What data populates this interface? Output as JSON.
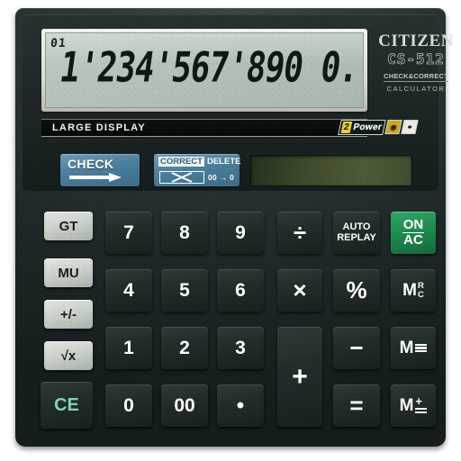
{
  "device": {
    "brand": "CITIZEN",
    "model": "CS-512",
    "subtitle_1": "CHECK&CORRECT",
    "subtitle_2": "CALCULATOR",
    "large_display_label": "LARGE DISPLAY",
    "power_badge": {
      "count": "2",
      "word": "Power",
      "solar_icon": "solar-cell-icon",
      "battery_icon": "battery-icon"
    }
  },
  "display": {
    "flag": "01",
    "value": "1'234'567'890 0.",
    "background_color": "#b4c3b8",
    "digit_color": "#0d1a14"
  },
  "secondary_display": {
    "value": "",
    "background_color": "#4d5a36"
  },
  "top_buttons": {
    "check": {
      "label": "CHECK",
      "icon": "right-arrow-icon",
      "color": "#4b7e9d"
    },
    "correct": {
      "label": "CORRECT",
      "secondary_label": "DELETE",
      "icon": "crossed-box-icon",
      "note": "00 → 0",
      "color": "#4b7e9d"
    }
  },
  "keys": {
    "function_column": [
      {
        "label": "GT",
        "name": "key-grand-total",
        "style": "gray"
      },
      {
        "label": "MU",
        "name": "key-markup",
        "style": "gray"
      },
      {
        "label": "+/-",
        "name": "key-sign-change",
        "style": "gray"
      },
      {
        "label": "√x",
        "name": "key-square-root",
        "style": "gray"
      },
      {
        "label": "CE",
        "name": "key-clear-entry",
        "style": "ce"
      }
    ],
    "numbers": [
      {
        "label": "7",
        "name": "key-7"
      },
      {
        "label": "8",
        "name": "key-8"
      },
      {
        "label": "9",
        "name": "key-9"
      },
      {
        "label": "4",
        "name": "key-4"
      },
      {
        "label": "5",
        "name": "key-5"
      },
      {
        "label": "6",
        "name": "key-6"
      },
      {
        "label": "1",
        "name": "key-1"
      },
      {
        "label": "2",
        "name": "key-2"
      },
      {
        "label": "3",
        "name": "key-3"
      },
      {
        "label": "0",
        "name": "key-0"
      },
      {
        "label": "00",
        "name": "key-double-zero"
      },
      {
        "label": "•",
        "name": "key-decimal-point"
      }
    ],
    "operators": {
      "divide": "÷",
      "multiply": "×",
      "percent": "%",
      "plus": "+",
      "minus": "−",
      "equals": "=",
      "auto_replay_line1": "AUTO",
      "auto_replay_line2": "REPLAY",
      "on_ac_line1": "ON",
      "on_ac_line2": "AC",
      "memory_recall": "M",
      "memory_recall_sup": "R",
      "memory_recall_sub": "C",
      "memory_minus": "M",
      "memory_minus_sign": "−",
      "memory_plus": "M",
      "memory_plus_sign": "+"
    }
  },
  "colors": {
    "body": "#222c2b",
    "accent_green": "#1d8a4e",
    "accent_blue": "#4b7e9d",
    "badge_yellow": "#e8cf2e"
  }
}
